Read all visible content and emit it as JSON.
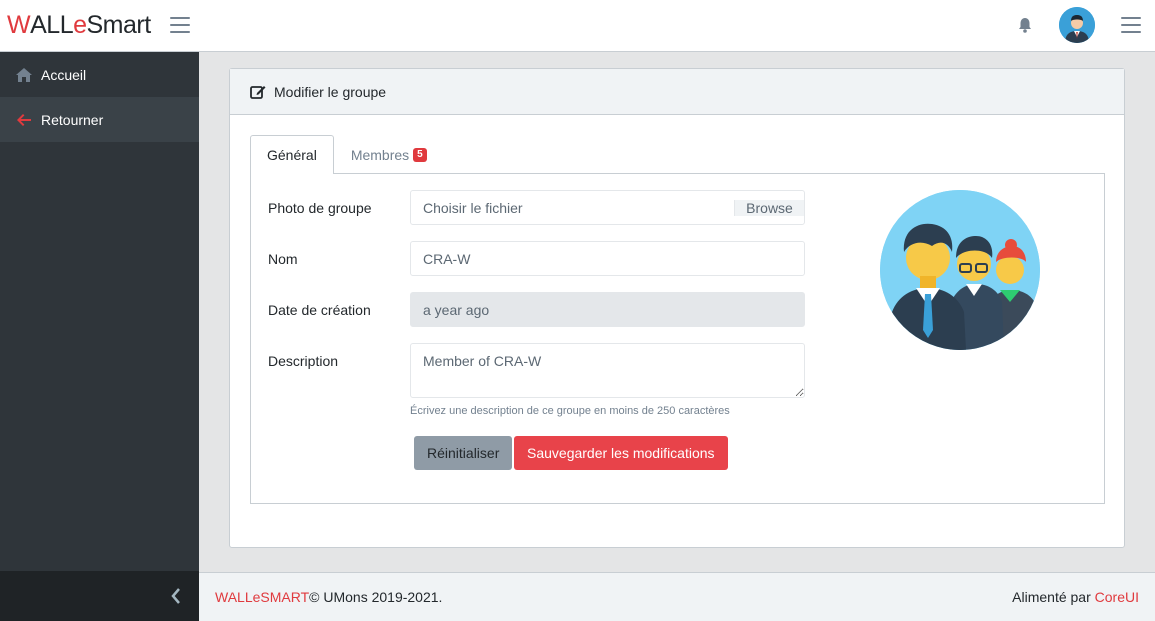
{
  "brand": {
    "w": "W",
    "a": "ALL",
    "e": "e",
    "smart": "Smart"
  },
  "sidebar": {
    "items": [
      {
        "label": "Accueil",
        "icon": "home-icon"
      },
      {
        "label": "Retourner",
        "icon": "arrow-left-icon"
      }
    ]
  },
  "card": {
    "title": "Modifier le groupe",
    "tabs": [
      {
        "label": "Général"
      },
      {
        "label": "Membres",
        "badge": "5"
      }
    ],
    "form": {
      "photo_label": "Photo de groupe",
      "photo_placeholder": "Choisir le fichier",
      "browse_label": "Browse",
      "name_label": "Nom",
      "name_value": "CRA-W",
      "date_label": "Date de création",
      "date_value": "a year ago",
      "description_label": "Description",
      "description_value": "Member of CRA-W",
      "description_help": "Écrivez une description de ce groupe en moins de 250 caractères",
      "reset_label": "Réinitialiser",
      "save_label": "Sauvegarder les modifications"
    }
  },
  "footer": {
    "brand_link": "WALLeSMART",
    "copyright": "© UMons 2019-2021.",
    "powered_by": "Alimenté par",
    "powered_link": "CoreUI"
  },
  "colors": {
    "accent": "#e03a3e",
    "sidebar_bg": "#2f353a",
    "save_button": "#e8434a",
    "reset_button": "#8f9ba6"
  }
}
